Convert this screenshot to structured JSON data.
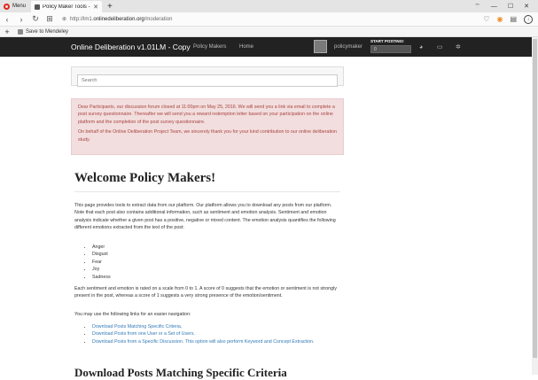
{
  "browser": {
    "menu_label": "Menu",
    "tab_title": "Policy Maker Tools - Onli",
    "url_prefix": "http://lm1.",
    "url_host": "onlinedeliberation.org",
    "url_path": "/moderation",
    "bookmark_label": "Save to Mendeley"
  },
  "site": {
    "brand": "Online Deliberation v1.01LM - Copy",
    "nav": [
      "Policy Makers",
      "Home"
    ],
    "username": "policymaker",
    "start_posting_label": "START POSTING!",
    "posting_value": "0",
    "search_placeholder": "Search"
  },
  "alert": {
    "para1": "Dear Participants, our discussion forum closed at 11:00pm on May 25, 2016. We will send you a link via email to complete a post survey questionnaire. Thereafter we will send you a reward redemption letter based on your participation on the online platform and the completion of the post survey questionnaire.",
    "para2": "On behalf of the Online Deliberation Project Team, we sincerely thank you for your kind contribution to our online deliberation study."
  },
  "main": {
    "title": "Welcome Policy Makers!",
    "intro": "This page provides tools to extract data from our platform. Our platform allows you to download any posts from our platform. Note that each post also contains additional information, such as sentiment and emotion analysis. Sentiment and emotion analysis indicate whether a given post has a positive, negative or mixed content. The emotion analysis quantifies the following different emotions extracted from the text of the post:",
    "emotions": [
      "Anger",
      "Disgust",
      "Fear",
      "Joy",
      "Sadness"
    ],
    "scale_text": "Each sentiment and emotion is rated on a scale from 0 to 1. A score of 0 suggests that the emotion or sentiment is not strongly present in the post, whereas a score of 1 suggests a very strong presence of the emotion/sentiment.",
    "nav_text": "You may use the following links for an easier navigation:",
    "links": [
      "Download Posts Matching Specific Criteria.",
      "Download Posts from one User or a Set of Users.",
      "Download Posts from a Specific Discussion. This option will also perform Keyword and Concept Extraction."
    ],
    "section_title": "Download Posts Matching Specific Criteria"
  }
}
